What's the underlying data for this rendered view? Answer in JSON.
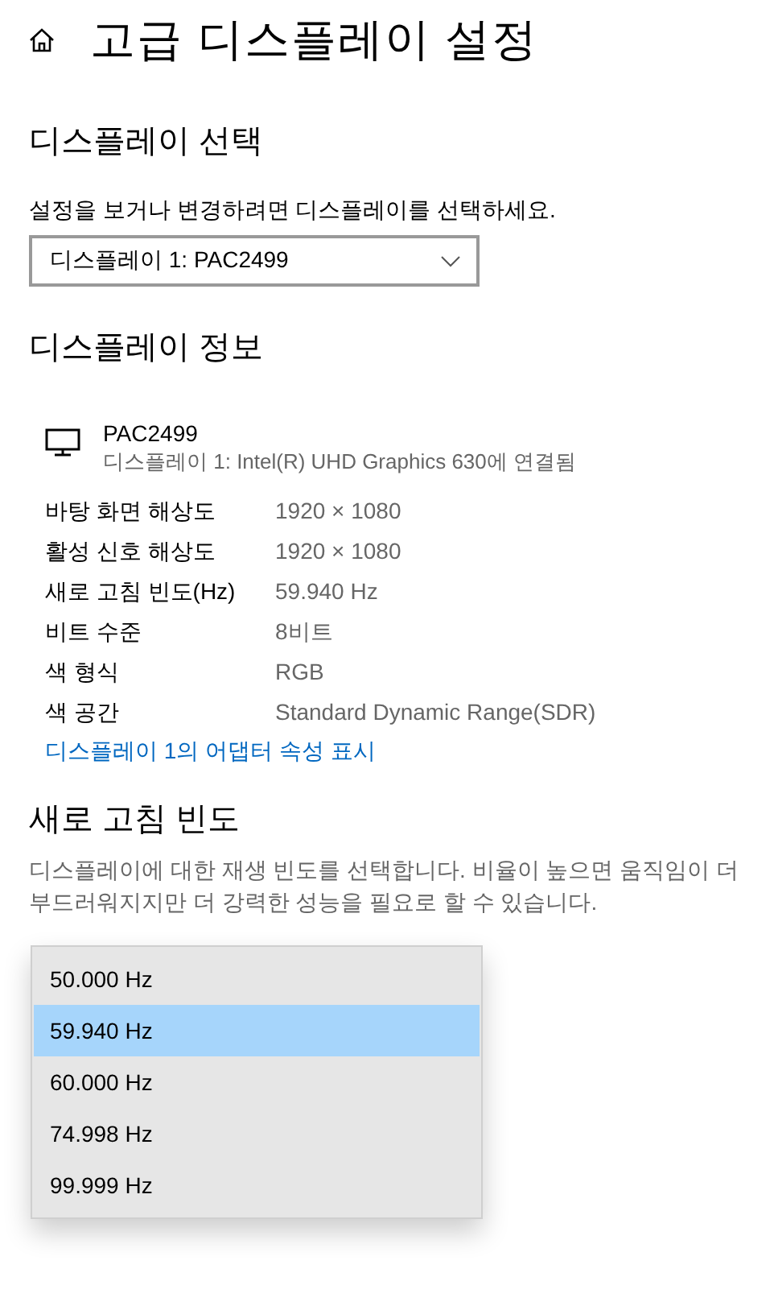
{
  "page": {
    "title": "고급 디스플레이 설정"
  },
  "display_select": {
    "heading": "디스플레이 선택",
    "description": "설정을 보거나 변경하려면 디스플레이를 선택하세요.",
    "value": "디스플레이 1: PAC2499"
  },
  "display_info": {
    "heading": "디스플레이 정보",
    "monitor_name": "PAC2499",
    "monitor_connection": "디스플레이 1: Intel(R) UHD Graphics 630에 연결됨",
    "rows": [
      {
        "label": "바탕 화면 해상도",
        "value": "1920 × 1080"
      },
      {
        "label": "활성 신호 해상도",
        "value": "1920 × 1080"
      },
      {
        "label": "새로 고침 빈도(Hz)",
        "value": "59.940 Hz"
      },
      {
        "label": "비트 수준",
        "value": "8비트"
      },
      {
        "label": "색 형식",
        "value": "RGB"
      },
      {
        "label": "색 공간",
        "value": "Standard Dynamic Range(SDR)"
      }
    ],
    "link": "디스플레이 1의 어댑터 속성 표시"
  },
  "refresh_rate": {
    "heading": "새로 고침 빈도",
    "description": "디스플레이에 대한 재생 빈도를 선택합니다. 비율이 높으면 움직임이 더 부드러워지지만 더 강력한 성능을 필요로 할 수 있습니다.",
    "options": [
      {
        "label": "50.000 Hz",
        "selected": false
      },
      {
        "label": "59.940 Hz",
        "selected": true
      },
      {
        "label": "60.000 Hz",
        "selected": false
      },
      {
        "label": "74.998 Hz",
        "selected": false
      },
      {
        "label": "99.999 Hz",
        "selected": false
      }
    ]
  }
}
